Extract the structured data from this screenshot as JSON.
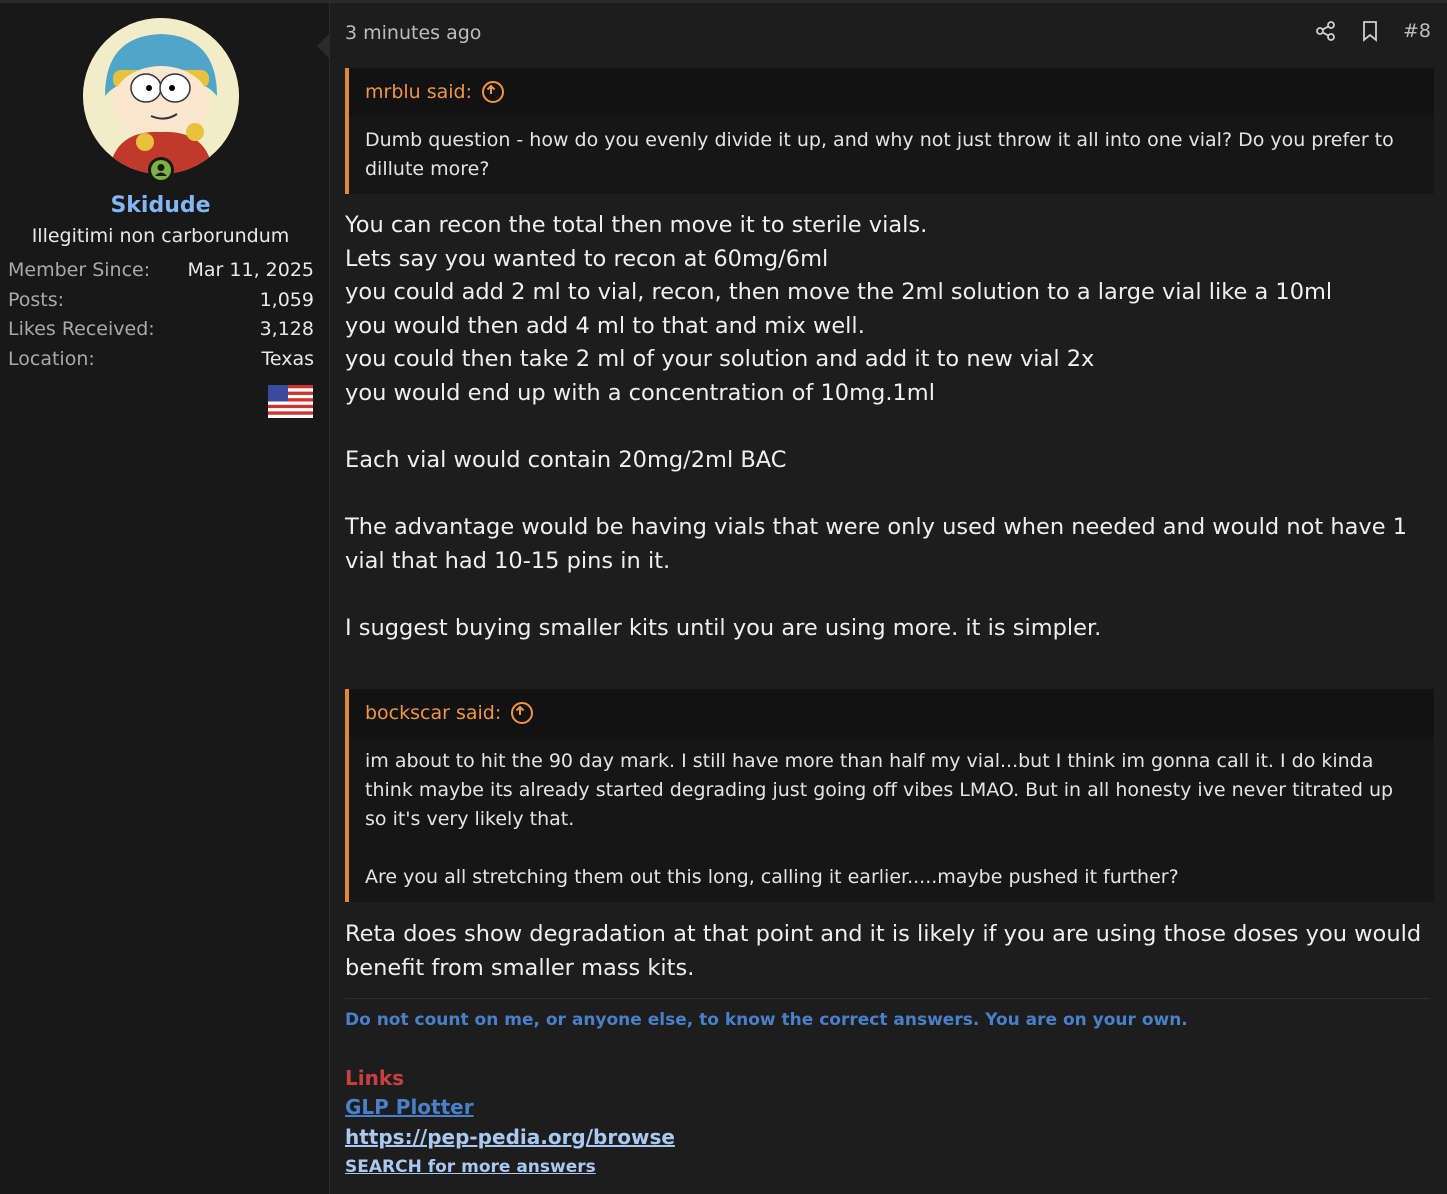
{
  "user": {
    "name": "Skidude",
    "title": "Illegitimi non carborundum",
    "stats": [
      {
        "label": "Member Since:",
        "value": "Mar 11, 2025"
      },
      {
        "label": "Posts:",
        "value": "1,059"
      },
      {
        "label": "Likes Received:",
        "value": "3,128"
      },
      {
        "label": "Location:",
        "value": "Texas"
      }
    ],
    "status": "online",
    "flag_icon": "us-flag-icon"
  },
  "post": {
    "time": "3 minutes ago",
    "number": "#8",
    "actions": [
      "share-icon",
      "bookmark-icon"
    ],
    "quote1": {
      "author": "mrblu said:",
      "text": "Dumb question - how do you evenly divide it up, and why not just throw it all into one vial? Do you prefer to dillute more?"
    },
    "body1": [
      "You can recon the total then move it to sterile vials.",
      "Lets say you wanted to recon at 60mg/6ml",
      "you could add 2 ml to vial, recon, then move the 2ml solution to a large vial like a 10ml",
      "you would then add 4 ml to that and mix well.",
      "you could then take 2 ml of your solution and add it to new vial 2x",
      "you would end up with a concentration of 10mg.1ml",
      "Each vial would contain 20mg/2ml BAC",
      "The advantage would be having vials that were only used when needed and would not have 1 vial that had 10-15 pins in it.",
      "I suggest buying smaller kits until you are using more. it is simpler."
    ],
    "quote2": {
      "author": "bockscar said:",
      "para1": "im about to hit the 90 day mark. I still have more than half my vial...but I think im gonna call it. I do kinda think maybe its already started degrading just going off vibes LMAO. But in all honesty ive never titrated up so it's very likely that.",
      "para2": "Are you all stretching them out this long, calling it earlier.....maybe pushed it further?"
    },
    "body2": "Reta does show degradation at that point and it is likely if you are using those doses you would benefit from smaller mass kits."
  },
  "signature": {
    "note": "Do not count on me, or anyone else, to know the correct answers. You are on your own.",
    "links_title": "Links",
    "links": [
      "GLP Plotter",
      "https://pep-pedia.org/browse",
      "SEARCH for more answers"
    ]
  },
  "colors": {
    "quote_border": "#e0893a",
    "username": "#82b6f5",
    "links_title": "#c94040",
    "online": "#7cb342"
  }
}
